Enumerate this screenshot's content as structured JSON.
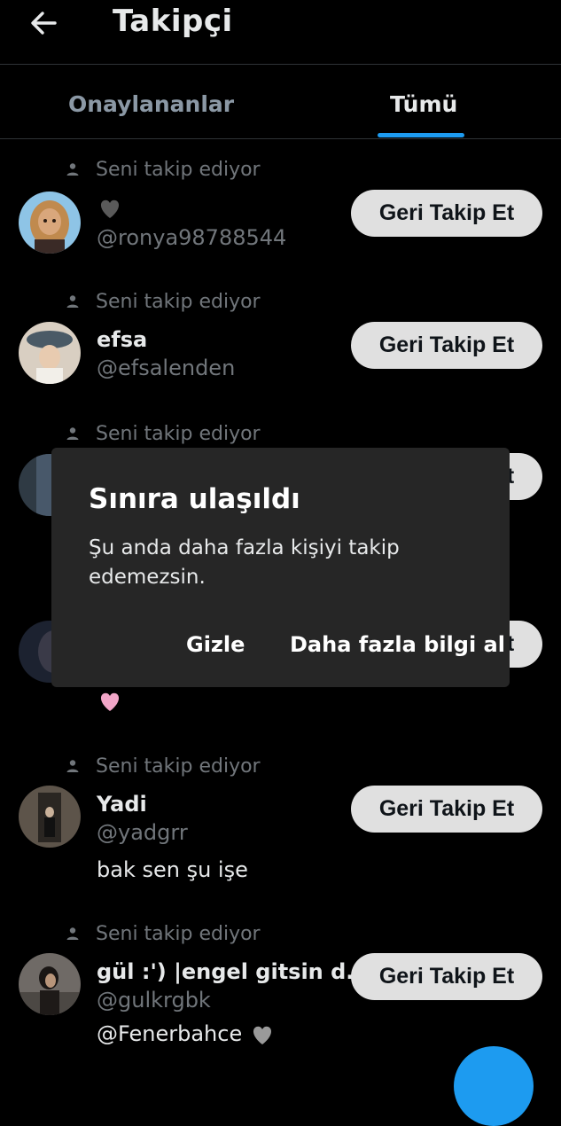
{
  "header": {
    "title": "Takipçi",
    "back_icon": "arrow-left-icon"
  },
  "tabs": [
    {
      "label": "Onaylananlar",
      "selected": false
    },
    {
      "label": "Tümü",
      "selected": true
    }
  ],
  "accent_color": "#1d9bf0",
  "followers": [
    {
      "context": "Seni takip ediyor",
      "name": "",
      "name_icon": "black-heart-icon",
      "handle": "@ronya98788544",
      "bio": "",
      "button": "Geri Takip Et"
    },
    {
      "context": "Seni takip ediyor",
      "name": "efsa",
      "handle": "@efsalenden",
      "bio": "",
      "button": "Geri Takip Et"
    },
    {
      "context": "Seni takip ediyor",
      "name": "",
      "handle": "",
      "bio": "",
      "button": "Geri Takip Et"
    },
    {
      "context": "",
      "name": "",
      "handle": "",
      "bio": "",
      "bio_icon": "pink-heart-icon",
      "button": "Geri Takip Et"
    },
    {
      "context": "Seni takip ediyor",
      "name": "Yadi",
      "handle": "@yadgrr",
      "bio": "bak sen şu işe",
      "button": "Geri Takip Et"
    },
    {
      "context": "Seni takip ediyor",
      "name": "gül :') |engel gitsin d...",
      "handle": "@gulkrgbk",
      "bio": "@Fenerbahce",
      "bio_icon": "white-heart-icon",
      "button": "Geri Takip Et"
    }
  ],
  "dialog": {
    "title": "Sınıra ulaşıldı",
    "body": "Şu anda daha fazla kişiyi takip edemezsin.",
    "hide_label": "Gizle",
    "more_label": "Daha fazla bilgi al"
  }
}
